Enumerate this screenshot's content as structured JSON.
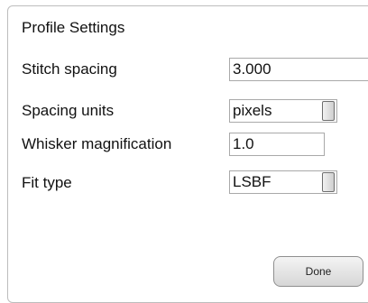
{
  "dialog": {
    "title": "Profile Settings",
    "done_label": "Done"
  },
  "fields": {
    "stitch_spacing": {
      "label": "Stitch spacing",
      "value": "3.000"
    },
    "spacing_units": {
      "label": "Spacing units",
      "value": "pixels"
    },
    "whisker_magnification": {
      "label": "Whisker magnification",
      "value": "1.0"
    },
    "fit_type": {
      "label": "Fit type",
      "value": "LSBF"
    }
  }
}
